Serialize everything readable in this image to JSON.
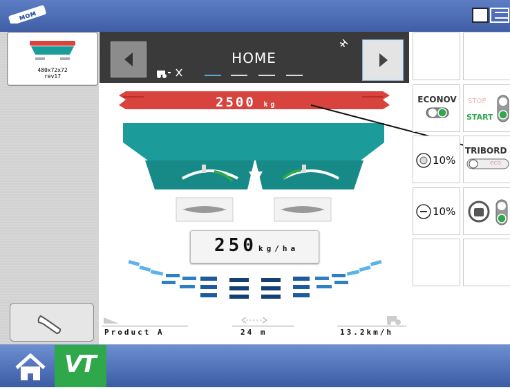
{
  "thumbnail": {
    "line1": "480x72x72",
    "line2": "rev17"
  },
  "header": {
    "title": "HOME"
  },
  "hopper": {
    "weight_value": "2500",
    "weight_unit": "kg"
  },
  "rate": {
    "value": "250",
    "unit": "kg/ha"
  },
  "grid": {
    "econov_label": "ECONOV",
    "stop_label": "STOP",
    "start_label": "START",
    "tribord_label": "TRIBORD",
    "eco_label": "eco",
    "adjust1_value": "10%",
    "adjust2_value": "10%"
  },
  "status": {
    "product": "Product A",
    "width": "24 m",
    "speed": "13.2km/h"
  },
  "bottom": {
    "vt_label": "VT"
  },
  "colors": {
    "accent_red": "#d9433d",
    "hopper_teal": "#1b9c9a",
    "vt_green": "#2ea84a",
    "bar_blue": "#4a6db7"
  }
}
